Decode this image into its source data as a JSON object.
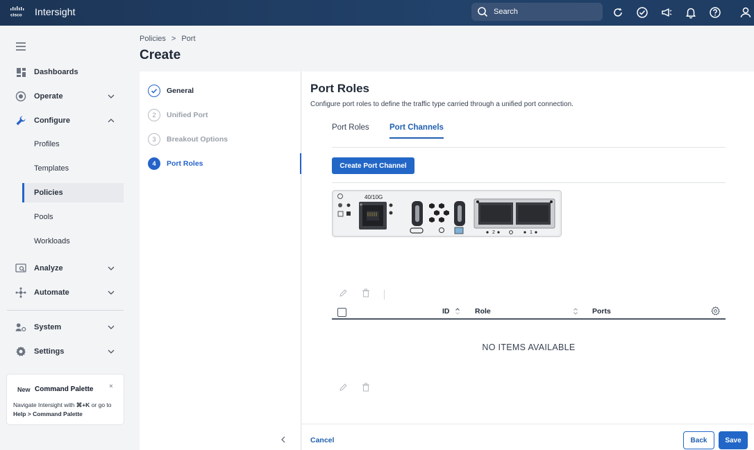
{
  "app": {
    "brand": "cisco",
    "name": "Intersight"
  },
  "search": {
    "placeholder": "Search"
  },
  "top_icons": [
    "refresh-icon",
    "check-circle-icon",
    "megaphone-icon",
    "bell-icon",
    "help-icon",
    "user-icon"
  ],
  "sidebar": {
    "items": [
      {
        "label": "Dashboards",
        "icon": "dashboard-icon"
      },
      {
        "label": "Operate",
        "icon": "operate-icon"
      },
      {
        "label": "Configure",
        "icon": "wrench-icon"
      },
      {
        "label": "Analyze",
        "icon": "analyze-icon"
      },
      {
        "label": "Automate",
        "icon": "automate-icon"
      },
      {
        "label": "System",
        "icon": "system-icon"
      },
      {
        "label": "Settings",
        "icon": "gear-icon"
      }
    ],
    "configure_sub": [
      "Profiles",
      "Templates",
      "Policies",
      "Pools",
      "Workloads"
    ],
    "active_sub": "Policies"
  },
  "command_palette": {
    "badge": "New",
    "title": "Command Palette",
    "close": "×",
    "desc_part1": "Navigate Intersight with ",
    "shortcut": "⌘+K",
    "desc_part2": " or go to ",
    "desc_part3": "Help > Command Palette"
  },
  "breadcrumb": {
    "parent": "Policies",
    "sep": ">",
    "current": "Port"
  },
  "page_title": "Create",
  "wizard": {
    "steps": [
      {
        "num": "1",
        "label": "General",
        "state": "done"
      },
      {
        "num": "2",
        "label": "Unified Port",
        "state": "pending"
      },
      {
        "num": "3",
        "label": "Breakout Options",
        "state": "pending"
      },
      {
        "num": "4",
        "label": "Port Roles",
        "state": "current"
      }
    ],
    "collapse": "<"
  },
  "main": {
    "title": "Port Roles",
    "description": "Configure port roles to define the traffic type carried through a unified port connection.",
    "tabs": [
      "Port Roles",
      "Port Channels"
    ],
    "active_tab": "Port Channels",
    "create_button": "Create Port Channel",
    "device_label": "40/10G",
    "device_port_labels": [
      "2",
      "1"
    ],
    "table": {
      "columns": [
        "ID",
        "Role",
        "Ports"
      ],
      "empty": "NO ITEMS AVAILABLE"
    }
  },
  "footer": {
    "cancel": "Cancel",
    "back": "Back",
    "save": "Save"
  },
  "colors": {
    "topbar": "#1f3a5f",
    "accent": "#2267c7"
  }
}
